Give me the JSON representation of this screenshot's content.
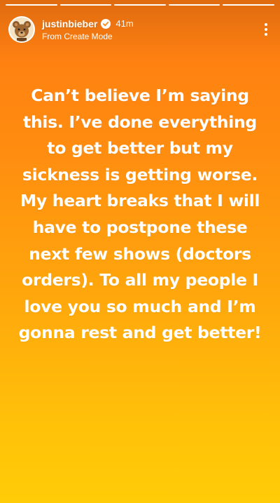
{
  "story": {
    "progress_segments": [
      1,
      1,
      1,
      1,
      1
    ],
    "background_colors": [
      "#ff7a12",
      "#ffa80c",
      "#ffcc07"
    ]
  },
  "header": {
    "username": "justinbieber",
    "verified_icon": "verified-badge-icon",
    "time": "41m",
    "subtitle": "From Create Mode",
    "more_icon": "more-vertical-icon"
  },
  "body_text": "Can’t believe I’m saying this. I’ve done everything to get better but my sickness is getting worse. My heart breaks that I will have to postpone these next few shows (doctors orders). To all my people I love you so much and I’m gonna rest and get better!"
}
